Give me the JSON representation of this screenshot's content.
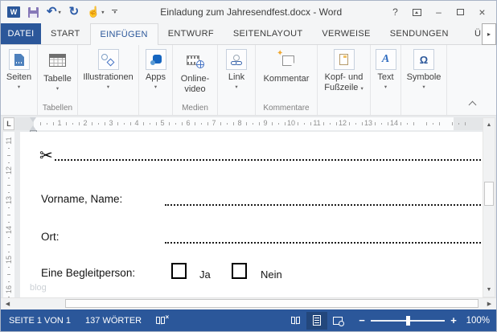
{
  "window": {
    "title": "Einladung zum Jahresendfest.docx - Word"
  },
  "icons": {
    "word_logo_letter": "W",
    "undo": "↶",
    "redo": "↻",
    "touch": "☝",
    "dropdown": "▾",
    "tab_scroll": "▸",
    "scroll_up": "▲",
    "scroll_down": "▼",
    "scroll_left": "◀",
    "scroll_right": "▶",
    "scissors": "✂",
    "star": "✦",
    "help": "?",
    "minimize": "–",
    "close": "×",
    "text_a": "A",
    "omega": "Ω"
  },
  "tabs": {
    "file": "DATEI",
    "items": [
      "START",
      "EINFÜGEN",
      "ENTWURF",
      "SEITENLAYOUT",
      "VERWEISE",
      "SENDUNGEN"
    ],
    "active": "EINFÜGEN",
    "overflow_partial": "Ü"
  },
  "ribbon": {
    "buttons": {
      "seiten": "Seiten",
      "tabelle": "Tabelle",
      "illustrationen": "Illustrationen",
      "apps": "Apps",
      "online_video": "Online-video",
      "link": "Link",
      "kommentar": "Kommentar",
      "kopf_fusszeile": "Kopf- und Fußzeile",
      "text": "Text",
      "symbole": "Symbole"
    },
    "groups": {
      "tabellen": "Tabellen",
      "medien": "Medien",
      "kommentare": "Kommentare"
    },
    "dropdown_glyph": "▾"
  },
  "rulers": {
    "tab_selector": "L",
    "horizontal_numbers": [
      "1",
      "2",
      "3",
      "4",
      "5",
      "6",
      "7",
      "8",
      "9",
      "10",
      "11",
      "12",
      "13",
      "14"
    ],
    "vertical_numbers": [
      "11",
      "12",
      "13",
      "14",
      "15",
      "16"
    ]
  },
  "document": {
    "fields": [
      {
        "label": "Vorname, Name:"
      },
      {
        "label": "Ort:"
      }
    ],
    "companion": {
      "label": "Eine Begleitperson:",
      "options": [
        {
          "label": "Ja",
          "checked": false
        },
        {
          "label": "Nein",
          "checked": false
        }
      ]
    },
    "watermark": "blog"
  },
  "statusbar": {
    "page_status": "SEITE 1 VON 1",
    "word_count": "137 WÖRTER",
    "zoom_minus": "−",
    "zoom_plus": "+",
    "zoom_level": "100%"
  },
  "colors": {
    "accent": "#2b579a",
    "statusbar_bg": "#2b579a",
    "active_tab_text": "#2b579a",
    "page_bg": "#ffffff"
  }
}
